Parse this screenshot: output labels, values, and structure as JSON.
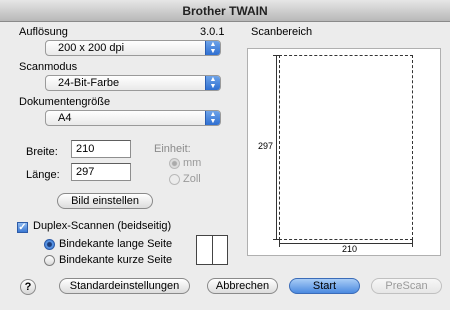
{
  "window": {
    "title": "Brother TWAIN"
  },
  "resolution": {
    "label": "Auflösung",
    "value": "200 x 200 dpi",
    "version": "3.0.1"
  },
  "scan_mode": {
    "label": "Scanmodus",
    "value": "24-Bit-Farbe"
  },
  "document_size": {
    "label": "Dokumentengröße",
    "value": "A4"
  },
  "width": {
    "label": "Breite:",
    "value": "210"
  },
  "length": {
    "label": "Länge:",
    "value": "297"
  },
  "unit": {
    "label": "Einheit:",
    "options": [
      {
        "label": "mm",
        "selected": true,
        "enabled": false
      },
      {
        "label": "Zoll",
        "selected": false,
        "enabled": false
      }
    ]
  },
  "adjust_image_button": "Bild einstellen",
  "duplex": {
    "label": "Duplex-Scannen (beidseitig)",
    "checked": true,
    "options": [
      {
        "label": "Bindekante lange Seite",
        "selected": true
      },
      {
        "label": "Bindekante kurze Seite",
        "selected": false
      }
    ]
  },
  "scan_area": {
    "label": "Scanbereich",
    "height_value": "297",
    "width_value": "210"
  },
  "buttons": {
    "help": "?",
    "defaults": "Standardeinstellungen",
    "cancel": "Abbrechen",
    "start": "Start",
    "prescan": "PreScan"
  }
}
